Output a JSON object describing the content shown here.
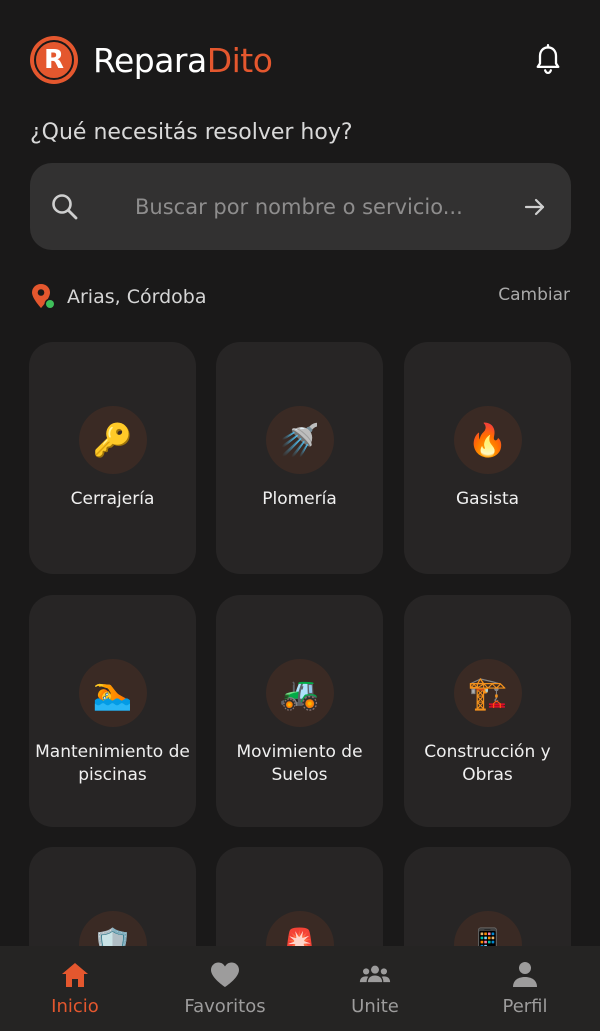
{
  "header": {
    "brand_part1": "Repara",
    "brand_part2": "Dito",
    "logo_letter": "R",
    "notification_icon": "bell-icon"
  },
  "prompt": "¿Qué necesitás resolver hoy?",
  "search": {
    "placeholder": "Buscar por nombre o servicio...",
    "value": "",
    "icon": "search-icon",
    "submit_icon": "arrow-right-icon"
  },
  "location": {
    "text": "Arias, Córdoba",
    "change_label": "Cambiar",
    "icon": "map-pin-icon"
  },
  "categories": [
    {
      "label": "Cerrajería",
      "emoji": "🔑"
    },
    {
      "label": "Plomería",
      "emoji": "🚿"
    },
    {
      "label": "Gasista",
      "emoji": "🔥"
    },
    {
      "label": "Mantenimiento de piscinas",
      "emoji": "🏊"
    },
    {
      "label": "Movimiento de Suelos",
      "emoji": "🚜"
    },
    {
      "label": "Construcción y Obras",
      "emoji": "🏗️"
    },
    {
      "label": "",
      "emoji": "🛡️"
    },
    {
      "label": "",
      "emoji": "🚨"
    },
    {
      "label": "",
      "emoji": "📱"
    }
  ],
  "nav": {
    "items": [
      {
        "label": "Inicio",
        "icon": "home-icon",
        "active": true
      },
      {
        "label": "Favoritos",
        "icon": "heart-icon",
        "active": false
      },
      {
        "label": "Unite",
        "icon": "group-icon",
        "active": false
      },
      {
        "label": "Perfil",
        "icon": "person-icon",
        "active": false
      }
    ]
  },
  "colors": {
    "background": "#1a1919",
    "accent": "#e4572e",
    "card": "#272525",
    "search_bg": "#323131",
    "location_dot": "#3fbf5a"
  }
}
